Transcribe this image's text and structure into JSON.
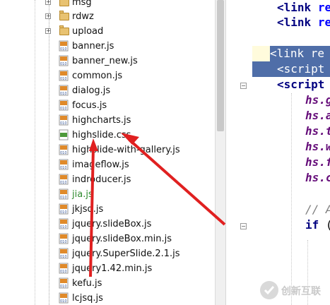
{
  "tree": {
    "items": [
      {
        "label": "msg",
        "type": "folder"
      },
      {
        "label": "rdwz",
        "type": "folder"
      },
      {
        "label": "upload",
        "type": "folder"
      },
      {
        "label": "banner.js",
        "type": "js"
      },
      {
        "label": "banner_new.js",
        "type": "js"
      },
      {
        "label": "common.js",
        "type": "js"
      },
      {
        "label": "dialog.js",
        "type": "js"
      },
      {
        "label": "focus.js",
        "type": "js"
      },
      {
        "label": "highcharts.js",
        "type": "js"
      },
      {
        "label": "highslide.css",
        "type": "css"
      },
      {
        "label": "highslide-with-gallery.js",
        "type": "js"
      },
      {
        "label": "imageflow.js",
        "type": "js"
      },
      {
        "label": "indroducer.js",
        "type": "js"
      },
      {
        "label": "jia.js",
        "type": "js"
      },
      {
        "label": "jkjsq.js",
        "type": "js"
      },
      {
        "label": "jquery.slideBox.js",
        "type": "js"
      },
      {
        "label": "jquery.slideBox.min.js",
        "type": "js"
      },
      {
        "label": "jquery.SuperSlide.2.1.js",
        "type": "js"
      },
      {
        "label": "jquery1.42.min.js",
        "type": "js"
      },
      {
        "label": "kefu.js",
        "type": "js"
      },
      {
        "label": "lcjsq.js",
        "type": "js"
      }
    ],
    "expander_symbol": "+",
    "file_badge_js": "JS",
    "file_badge_css": "CSS"
  },
  "editor": {
    "line1_tag": "<link",
    "line1_attr": "re",
    "line2_tag": "<link",
    "line2_attr": "re",
    "line4_text": "<link re",
    "line5_text": "<script",
    "line6_tag": "<script",
    "hs_lines": [
      "hs.g",
      "hs.a",
      "hs.t",
      "hs.w",
      "hs.f",
      "hs.c"
    ],
    "comment_line": "// A",
    "if_kw": "if",
    "if_rest": " (",
    "fold_minus": "−"
  },
  "colors": {
    "selection": "#4f6ea8",
    "arrow": "#e02020",
    "current_line": "#fffbdc"
  },
  "watermark": {
    "icon": "watermark-logo-icon",
    "text": "创新互联"
  }
}
